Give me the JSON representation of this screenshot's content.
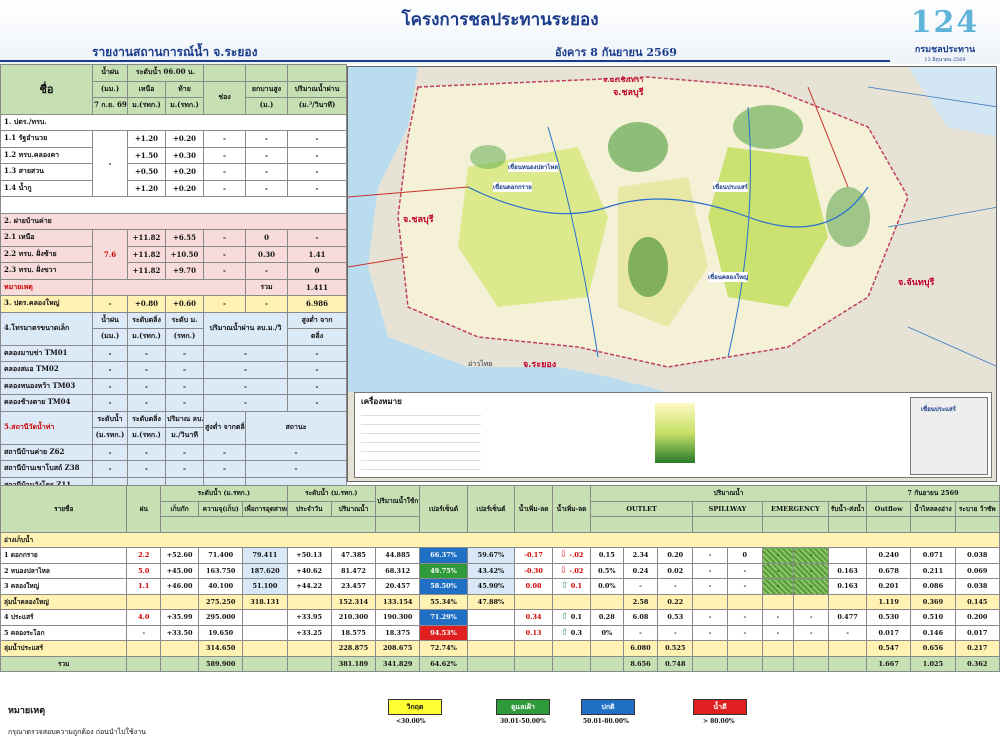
{
  "header": {
    "title": "โครงการชลประทานระยอง",
    "subtitle": "รายงานสถานการณ์น้ำ จ.ระยอง",
    "date": "อังคาร 8  กันยายน 2569",
    "logo_num": "124",
    "logo_name": "กรมชลประทาน",
    "logo_small": "13 มิถุนายน 2569"
  },
  "left": {
    "h_name": "ชื่อ",
    "h_rain": "น้ำฝน",
    "h_rain_u": "(มม.)",
    "h_date": "7 ก.ย. 69",
    "h_level": "ระดับน้ำ 06.00 น.",
    "h_level2": "8 กันยายน 2569",
    "h_up": "เหนือ",
    "h_down": "ท้าย",
    "h_ch": "ช่อง",
    "h_gate": "ยกบานสูง",
    "h_flow": "ปริมาณน้ำผ่าน",
    "h_u1": "ม.(รทก.)",
    "h_u2": "ม.(รทก.)",
    "h_u3": "(ม.)",
    "h_u4": "(ม.³/วินาที)",
    "s1": "1.  ปตร./ทรบ.",
    "r1": [
      [
        "1.1  รัฐอำนวย",
        "+1.20",
        "+0.20",
        "-",
        "-"
      ],
      [
        "1.2  ทรบ.คลองคา",
        "+1.50",
        "+0.30",
        "-",
        "-"
      ],
      [
        "1.3  สายสวน",
        "+0.50",
        "+0.20",
        "-",
        "-"
      ],
      [
        "1.4 น้ำกู",
        "+1.20",
        "+0.20",
        "-",
        "-"
      ]
    ],
    "s2": "2.  ฝายบ้านค่าย",
    "r2": [
      [
        "2.1  เหนือ",
        "+11.82",
        "+6.55",
        "-",
        "0",
        "-"
      ],
      [
        "2.2  ทรบ. ฝั่งซ้าย",
        "+11.82",
        "+10.50",
        "-",
        "0.30",
        "1.41"
      ],
      [
        "2.3  ทรบ. ฝั่งขวา",
        "+11.82",
        "+9.70",
        "-",
        "-",
        "0"
      ]
    ],
    "rain2": "7.6",
    "note": "หมายเหตุ",
    "total_lbl": "รวม",
    "total": "1.411",
    "s3": "3.  ปตร.คลองใหญ่",
    "s3v": [
      "-",
      "+0.80",
      "+0.60",
      "-",
      "-",
      "6.986"
    ],
    "s4": "4.โทรมาตรขนาดเล็ก",
    "h4": [
      "น้ำฝน",
      "(มม.)",
      "ระดับตลิ่ง",
      "ม.(รทก.)",
      "ระดับ ม.",
      "(รทก.)",
      "ปริมาณน้ำผ่าน ลบ.ม./วิ",
      "สูงต่ำ  จาก",
      "ตลิ่ง"
    ],
    "r4": [
      [
        "คลองมาบข่า   TM01",
        "-",
        "-",
        "-",
        "-",
        "-"
      ],
      [
        "คลองสแอ      TM02",
        "-",
        "-",
        "-",
        "-",
        "-"
      ],
      [
        "คลองหนองหว้า TM03",
        "-",
        "-",
        "-",
        "-",
        "-"
      ],
      [
        "คลองช้างตาย  TM04",
        "-",
        "-",
        "-",
        "-",
        "-"
      ]
    ],
    "s5": "5.สถานีวัดน้ำท่า",
    "h5": [
      "ระดับน้ำ",
      "(ม.รทก.)",
      "ระดับตลิ่ง",
      "ม.(รทก.)",
      "ปริมาณ  ลบ.",
      "ม./วินาที",
      "สูงต่ำ  จากตลิ่ง",
      "สถานะ"
    ],
    "r5": [
      [
        "สถานีบ้านค่าย  Z62",
        "-",
        "-",
        "-",
        "-",
        "-"
      ],
      [
        "สถานีบ้านเขาโบสถ์ Z38",
        "-",
        "-",
        "-",
        "-",
        "-"
      ],
      [
        "สถานีบ้านวังโตร Z11",
        "-",
        "-",
        "-",
        "-",
        "-"
      ]
    ]
  },
  "map": {
    "prov1": "จ.ชลบุรี",
    "prov2": "จ.ระยอง",
    "prov3": "จ.จันทบุรี",
    "prov4": "จ.ฉะเชิงเทรา",
    "sea": "อ่าวไทย",
    "legend": "เครื่องหมาย",
    "d1": "เขื่อนประแสร์",
    "d2": "เขื่อนหนองปลาไหล",
    "d3": "เขื่อนดอกกราย",
    "d4": "เขื่อนคลองใหญ่",
    "inset": "เขื่อนประแสร์"
  },
  "bottom": {
    "hd": [
      "อ่างเก็บน้ำ",
      "ฝน",
      "ระดับน้ำ (ม.รทก.)",
      "ระดับน้ำ (ม.รทก.)",
      "ปริมาณน้ำใช้การ",
      "เปอร์เซ็นต์",
      "เปอร์เซ็นต์",
      "น้ำเพิ่ม-ลด",
      "น้ำเพิ่ม-ลด",
      "ปริมาณน้ำ",
      "7 กันยายน 2569"
    ],
    "cols": [
      "รายชื่อ",
      "ฝน",
      "เก็บกัก",
      "ความจุ(เก็บ)",
      "เพื่อการอุตสาหกรรม",
      "ประจำวัน",
      "ปริมาณน้ำ",
      "ใช้การ",
      "ความจุ",
      "ใช้การ",
      "ม.",
      "ลบ.ม.",
      "OUTLET",
      "SPILLWAY",
      "EMERGENCY",
      "รับน้ำ-ส่งน้ำ",
      "Outflow",
      "น้ำไหลลงอ่าง",
      "ระบาย ว้าซัพ"
    ],
    "sec1": "อ่างเก็บน้ำ",
    "rows": [
      [
        "1  ดอกกราย",
        "2.2",
        "+52.60",
        "71.400",
        "79.411",
        "+50.13",
        "47.385",
        "44.885",
        "66.37%",
        "59.67%",
        "-0.17",
        "-.02",
        "0.15",
        "2.34",
        "0.20",
        "-",
        "0",
        "-",
        "-",
        "",
        "0.240",
        "0.071",
        "0.038"
      ],
      [
        "2  หนองปลาไหล",
        "5.0",
        "+45.00",
        "163.750",
        "187.620",
        "+40.62",
        "81.472",
        "68.312",
        "49.75%",
        "43.42%",
        "-0.30",
        "-.02",
        "0.5%",
        "0.24",
        "0.02",
        "-",
        "-",
        "-",
        "-",
        "0.163",
        "0.678",
        "0.211",
        "0.069"
      ],
      [
        "3  คลองใหญ่",
        "1.1",
        "+46.00",
        "40.100",
        "51.100",
        "+44.22",
        "23.457",
        "20.457",
        "58.50%",
        "45.90%",
        "0.08",
        "0.1",
        "0.0%",
        "-",
        "-",
        "-",
        "-",
        "-",
        "-",
        "0.163",
        "0.201",
        "0.086",
        "0.038"
      ]
    ],
    "sum1": [
      "ลุ่มน้ำคลองใหญ่",
      "275.250",
      "318.131",
      "152.314",
      "133.154",
      "55.34%",
      "47.88%",
      "2.58",
      "0.22",
      "1.119",
      "0.369",
      "0.145"
    ],
    "rows2": [
      [
        "4  ประแสร์",
        "4.0",
        "+35.99",
        "295.000",
        "+33.95",
        "210.300",
        "190.300",
        "71.29%",
        "0.34",
        "0.1",
        "0.28",
        "6.08",
        "0.53",
        "0.477",
        "0.530",
        "0.510",
        "0.200"
      ],
      [
        "5  คลองระโอก",
        "-",
        "+33.50",
        "19.650",
        "+33.25",
        "18.575",
        "18.375",
        "94.53%",
        "0.13",
        "0.3",
        "0%",
        "-",
        "-",
        "-",
        "0.017",
        "0.146",
        "0.017"
      ]
    ],
    "sum2": [
      "ลุ่มน้ำประแสร์",
      "314.650",
      "228.875",
      "208.675",
      "72.74%",
      "6.080",
      "0.525",
      "0.547",
      "0.656",
      "0.217"
    ],
    "total": [
      "รวม",
      "589.900",
      "381.189",
      "341.829",
      "64.62%",
      "8.656",
      "0.748",
      "1.667",
      "1.025",
      "0.362"
    ]
  },
  "footer": {
    "note": "หมายเหตุ",
    "note2": "กรุณาตรวจสอบความถูกต้อง ก่อนนำไปใช้งาน",
    "l1": "วิกฤต",
    "l1v": "<30.00%",
    "l2": "ดูแลเฝ้า",
    "l2v": "30.01-50.00%",
    "l3": "ปกติ",
    "l3v": "50.01-80.00%",
    "l4": "น้ำดี",
    "l4v": "> 80.00%"
  }
}
